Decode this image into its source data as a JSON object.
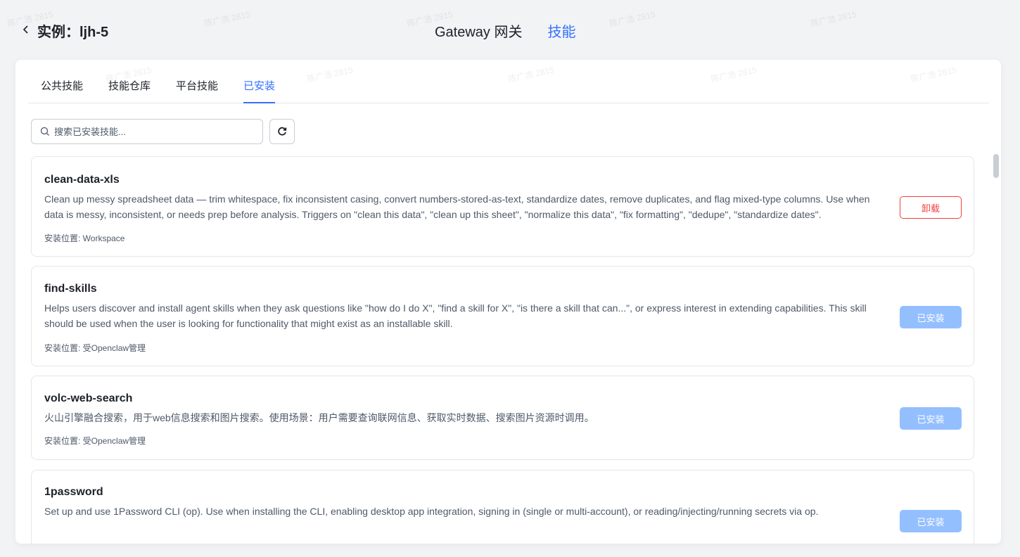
{
  "header": {
    "back_icon": "chevron-left-icon",
    "instance_title": "实例：ljh-5",
    "nav": [
      {
        "label": "Gateway 网关",
        "active": false
      },
      {
        "label": "技能",
        "active": true
      }
    ]
  },
  "watermark_text": "陈广浩 2815",
  "tabs": [
    {
      "label": "公共技能",
      "active": false
    },
    {
      "label": "技能仓库",
      "active": false
    },
    {
      "label": "平台技能",
      "active": false
    },
    {
      "label": "已安装",
      "active": true
    }
  ],
  "search": {
    "placeholder": "搜索已安装技能...",
    "value": "",
    "icon": "search-icon",
    "refresh_icon": "refresh-icon"
  },
  "skills": [
    {
      "name": "clean-data-xls",
      "description": "Clean up messy spreadsheet data — trim whitespace, fix inconsistent casing, convert numbers-stored-as-text, standardize dates, remove duplicates, and flag mixed-type columns. Use when data is messy, inconsistent, or needs prep before analysis. Triggers on \"clean this data\", \"clean up this sheet\", \"normalize this data\", \"fix formatting\", \"dedupe\", \"standardize dates\".",
      "location": "安装位置: Workspace",
      "button": "卸载",
      "button_type": "uninstall"
    },
    {
      "name": "find-skills",
      "description": "Helps users discover and install agent skills when they ask questions like \"how do I do X\", \"find a skill for X\", \"is there a skill that can...\", or express interest in extending capabilities. This skill should be used when the user is looking for functionality that might exist as an installable skill.",
      "location": "安装位置: 受Openclaw管理",
      "button": "已安装",
      "button_type": "installed"
    },
    {
      "name": "volc-web-search",
      "description": "火山引擎融合搜索，用于web信息搜索和图片搜索。使用场景：用户需要查询联网信息、获取实时数据、搜索图片资源时调用。",
      "location": "安装位置: 受Openclaw管理",
      "button": "已安装",
      "button_type": "installed"
    },
    {
      "name": "1password",
      "description": "Set up and use 1Password CLI (op). Use when installing the CLI, enabling desktop app integration, signing in (single or multi-account), or reading/injecting/running secrets via op.",
      "location": "",
      "button": "已安装",
      "button_type": "installed"
    }
  ],
  "colors": {
    "accent": "#3370ff",
    "danger": "#f53f3f",
    "installed_button": "#94bfff"
  }
}
